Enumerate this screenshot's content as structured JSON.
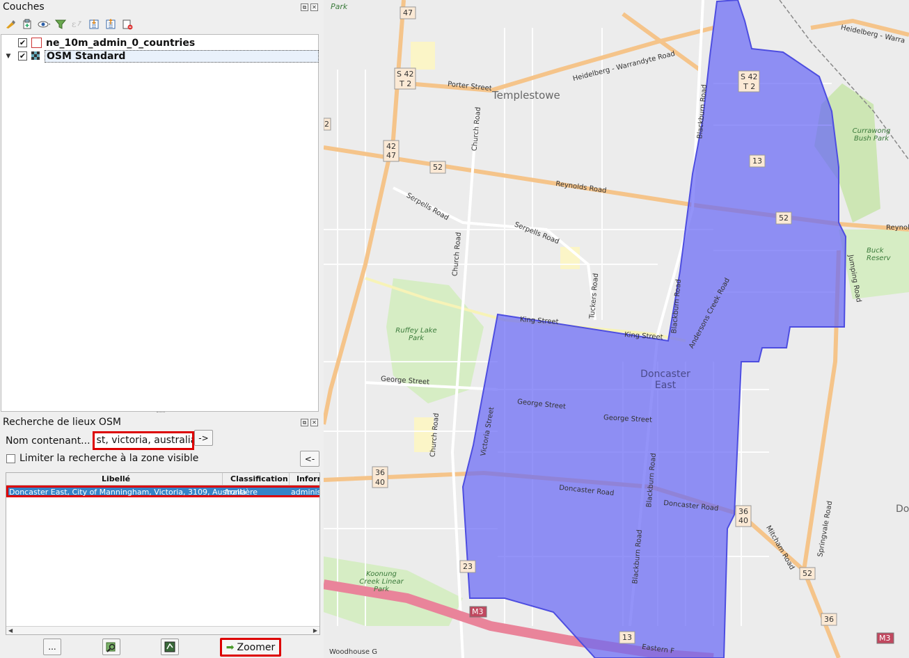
{
  "layers_panel": {
    "title": "Couches",
    "layers": [
      {
        "name": "ne_10m_admin_0_countries",
        "checked": true,
        "expander": ""
      },
      {
        "name": "OSM Standard",
        "checked": true,
        "expander": "▼"
      }
    ],
    "toolbar_icons": [
      "style-manager-icon",
      "add-group-icon",
      "visibility-icon",
      "filter-legend-icon",
      "filter-expression-icon",
      "expand-all-icon",
      "collapse-all-icon",
      "remove-layer-icon"
    ]
  },
  "osm_panel": {
    "title": "Recherche de lieux OSM",
    "name_label": "Nom contenant...",
    "search_value": "st, victoria, australia",
    "go_button": "->",
    "limit_label": "Limiter la recherche à la zone visible",
    "back_button": "<-",
    "columns": [
      "Libellé",
      "Classification",
      "Inform"
    ],
    "results": [
      {
        "label": "Doncaster East, City of Manningham, Victoria, 3109, Australia",
        "classification": "frontière",
        "info": "administ"
      }
    ],
    "buttons": {
      "more": "...",
      "zoom": "Zoomer"
    }
  },
  "map": {
    "highlight_color": "#6a6af5",
    "labels": {
      "park": "Park",
      "templestowe": "Templestowe",
      "porter_street": "Porter Street",
      "heidelberg_warrandyte_road": "Heidelberg - Warrandyte Road",
      "heidelberg_w": "Heidelberg - Warra",
      "church_road": "Church Road",
      "reynolds_road": "Reynolds Road",
      "reynolds_edge": "Reynol",
      "serpells_road_1": "Serpells Road",
      "serpells_road_2": "Serpells Road",
      "blackburn_road": "Blackburn Road",
      "andersons_creek_road": "Andersons Creek Road",
      "king_street": "King Street",
      "ruffey_lake_park": "Ruffey Lake Park",
      "george_street": "George Street",
      "doncaster_east": "Doncaster East",
      "doncaster_road": "Doncaster Road",
      "victoria_street": "Victoria Street",
      "tuckers_road": "Tuckers Road",
      "mitcham_road": "Mitcham Road",
      "springvale_road": "Springvale Road",
      "currawong_bush_park": "Currawong Bush Park",
      "buck_reserve": "Buck Reserv",
      "koonung_creek_linear_park": "Koonung Creek Linear Park",
      "woodhouse": "Woodhouse G",
      "eastern_freeway": "Eastern F",
      "do_edge": "Do",
      "jumping_road": "Jumping Road"
    },
    "shields": [
      "47",
      "S 42",
      "T 2",
      "42",
      "47",
      "52",
      "13",
      "52",
      "36",
      "40",
      "36",
      "40",
      "52",
      "36",
      "M3",
      "M3",
      "13",
      "23",
      "2"
    ]
  }
}
